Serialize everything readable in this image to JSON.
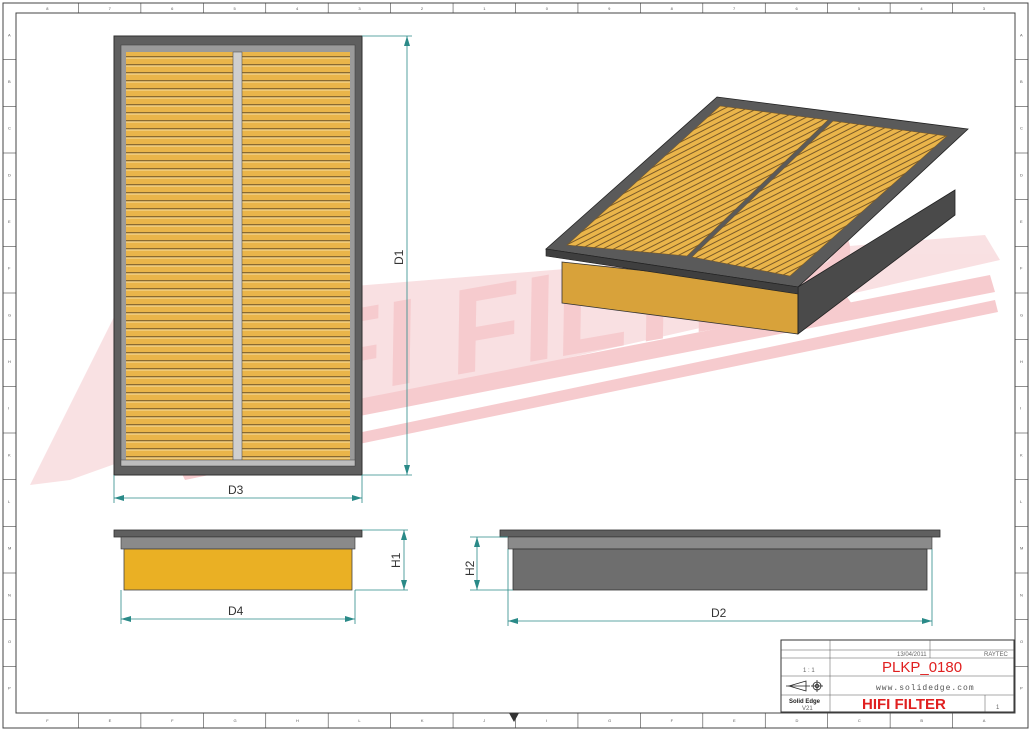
{
  "drawing": {
    "dimensions": {
      "d1": "D1",
      "d2": "D2",
      "d3": "D3",
      "d4": "D4",
      "h1": "H1",
      "h2": "H2"
    },
    "watermark": "HIFI FILTER",
    "colors": {
      "media": "#eab54a",
      "media_light": "#f3cf82",
      "frame": "#5f5f5f",
      "frame_dark": "#3f3f3f",
      "dimension_line": "#2a8a88",
      "watermark": "#f6c9cc",
      "brand_red": "#e02020"
    }
  },
  "title_block": {
    "date": "13/04/2011",
    "author": "RAYTEC",
    "scale": "1 : 1",
    "part_number": "PLKP_0180",
    "website": "www.solidedge.com",
    "software": "Solid Edge",
    "software_sub": "V21",
    "brand": "HIFI FILTER",
    "sheet": "1"
  },
  "border_zones": {
    "top": [
      "8",
      "7",
      "6",
      "5",
      "4",
      "3",
      "2",
      "1",
      "0",
      "9",
      "8",
      "7",
      "6",
      "5",
      "4",
      "3"
    ],
    "bottom": [
      "F",
      "E",
      "F",
      "G",
      "H",
      "L",
      "K",
      "J",
      "I",
      "G",
      "F",
      "E",
      "D",
      "C",
      "B",
      "A"
    ],
    "left": [
      "A",
      "B",
      "C",
      "D",
      "E",
      "F",
      "G",
      "H",
      "I",
      "K",
      "L",
      "M",
      "N",
      "O",
      "P"
    ],
    "right": [
      "A",
      "B",
      "C",
      "D",
      "E",
      "F",
      "G",
      "H",
      "I",
      "K",
      "L",
      "M",
      "N",
      "O",
      "P"
    ]
  }
}
